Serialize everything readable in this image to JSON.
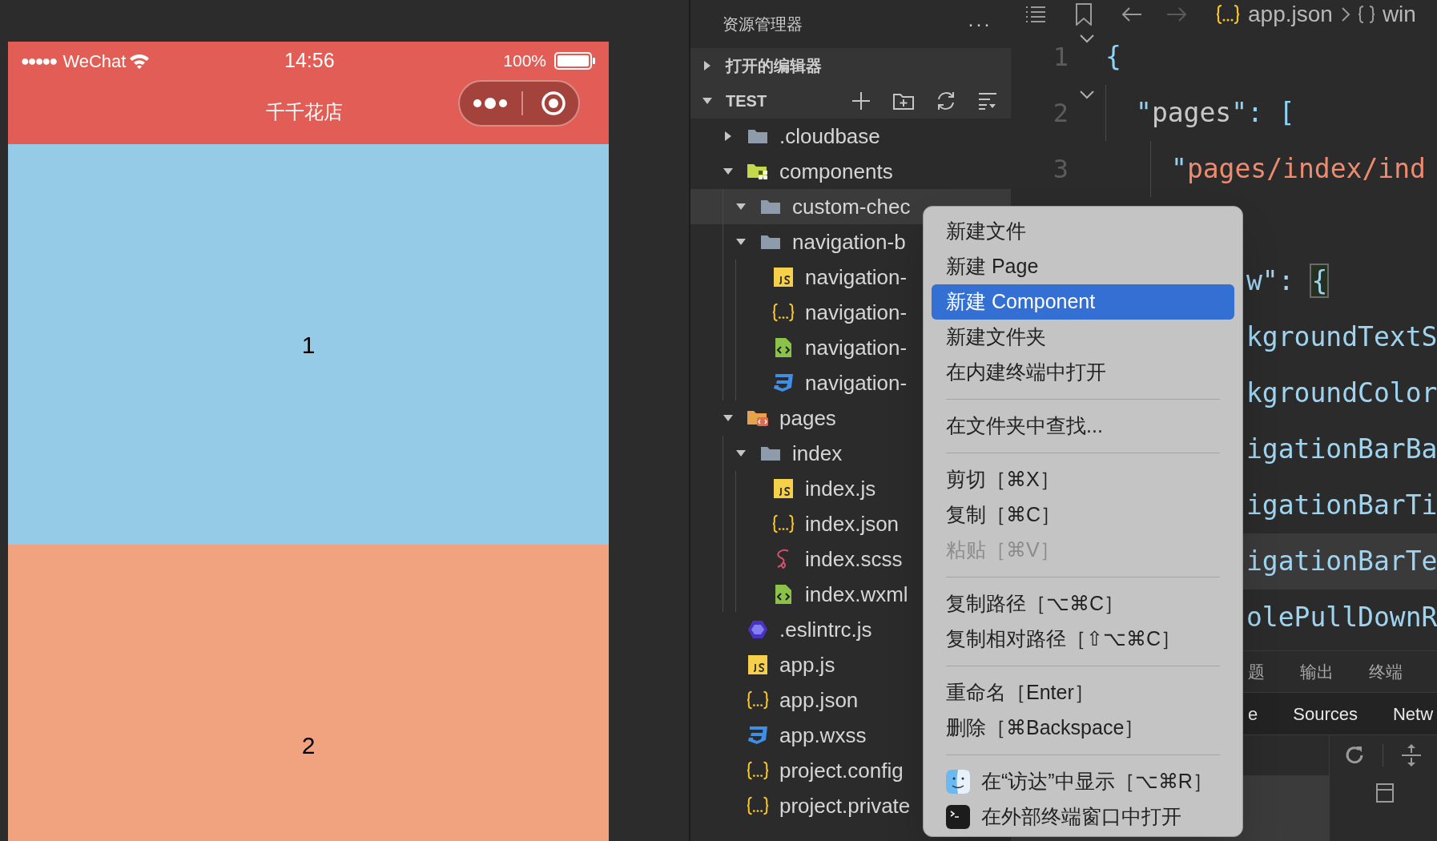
{
  "phone": {
    "status_bar": {
      "signal": "●●●●●",
      "carrier": "WeChat",
      "time": "14:56",
      "battery": "100%"
    },
    "title": "千千花店",
    "blocks": [
      {
        "label": "1",
        "color": "#96cbe8"
      },
      {
        "label": "2",
        "color": "#f1a27f"
      }
    ]
  },
  "explorer": {
    "title": "资源管理器",
    "more": "···",
    "sections": [
      {
        "label": "打开的编辑器",
        "expanded": false
      },
      {
        "label": "TEST",
        "expanded": true
      }
    ],
    "tree": [
      {
        "name": ".cloudbase",
        "kind": "folder",
        "expanded": false,
        "selected": false
      },
      {
        "name": "components",
        "kind": "components",
        "expanded": true,
        "selected": false,
        "children": [
          {
            "name": "custom-chec",
            "kind": "folder",
            "expanded": true,
            "selected": true
          },
          {
            "name": "navigation-b",
            "kind": "folder",
            "expanded": true,
            "selected": false,
            "children": [
              {
                "name": "navigation-",
                "kind": "js",
                "selected": false
              },
              {
                "name": "navigation-",
                "kind": "json",
                "selected": false
              },
              {
                "name": "navigation-",
                "kind": "wxml",
                "selected": false
              },
              {
                "name": "navigation-",
                "kind": "wxss",
                "selected": false
              }
            ]
          }
        ]
      },
      {
        "name": "pages",
        "kind": "pages",
        "expanded": true,
        "selected": false,
        "children": [
          {
            "name": "index",
            "kind": "folder",
            "expanded": true,
            "selected": false,
            "children": [
              {
                "name": "index.js",
                "kind": "js",
                "selected": false
              },
              {
                "name": "index.json",
                "kind": "json",
                "selected": false
              },
              {
                "name": "index.scss",
                "kind": "scss",
                "selected": false
              },
              {
                "name": "index.wxml",
                "kind": "wxml",
                "selected": false
              }
            ]
          }
        ]
      },
      {
        "name": ".eslintrc.js",
        "kind": "eslint",
        "selected": false
      },
      {
        "name": "app.js",
        "kind": "js",
        "selected": false
      },
      {
        "name": "app.json",
        "kind": "json",
        "selected": false
      },
      {
        "name": "app.wxss",
        "kind": "wxss",
        "selected": false
      },
      {
        "name": "project.config",
        "kind": "json",
        "selected": false
      },
      {
        "name": "project.private",
        "kind": "json",
        "selected": false
      }
    ]
  },
  "editor": {
    "breadcrumb": {
      "file": "app.json",
      "symbol": "win"
    },
    "lines": [
      {
        "kind": "full",
        "number": "1",
        "fold": true,
        "highlighted": false,
        "tokens": [
          {
            "text": "{",
            "kind": "punct"
          }
        ]
      },
      {
        "kind": "full",
        "number": "2",
        "fold": true,
        "highlighted": false,
        "tokens": [
          {
            "text": "\"",
            "kind": "punct"
          },
          {
            "text": "pages",
            "kind": "key"
          },
          {
            "text": "\": [",
            "kind": "punct"
          }
        ]
      },
      {
        "kind": "full",
        "number": "3",
        "highlighted": false,
        "tokens": [
          {
            "text": "\"",
            "kind": "punct"
          },
          {
            "text": "pages/index/ind",
            "kind": "string"
          }
        ]
      },
      {
        "kind": "hidden"
      },
      {
        "kind": "partial",
        "highlighted": false,
        "tokens": [
          {
            "text": "w\": ",
            "kind": "prop"
          },
          {
            "text": "{",
            "kind": "bracket-match"
          }
        ]
      },
      {
        "kind": "partial",
        "highlighted": false,
        "tokens": [
          {
            "text": "kgroundTextS",
            "kind": "prop"
          }
        ]
      },
      {
        "kind": "partial",
        "highlighted": false,
        "tokens": [
          {
            "text": "kgroundColor",
            "kind": "prop"
          }
        ]
      },
      {
        "kind": "partial",
        "highlighted": false,
        "tokens": [
          {
            "text": "igationBarBa",
            "kind": "prop"
          }
        ]
      },
      {
        "kind": "partial",
        "highlighted": false,
        "tokens": [
          {
            "text": "igationBarTi",
            "kind": "prop"
          }
        ]
      },
      {
        "kind": "partial",
        "highlighted": true,
        "tokens": [
          {
            "text": "igationBarTe",
            "kind": "prop"
          }
        ]
      },
      {
        "kind": "partial",
        "highlighted": false,
        "tokens": [
          {
            "text": "olePullDownR",
            "kind": "prop"
          }
        ]
      }
    ],
    "panel_tabs": [
      "题",
      "输出",
      "终端"
    ],
    "devtools_tabs": [
      "e",
      "Sources",
      "Netw"
    ]
  },
  "context_menu": [
    {
      "kind": "item",
      "label": "新建文件",
      "selected": false,
      "disabled": false
    },
    {
      "kind": "item",
      "label": "新建 Page",
      "selected": false,
      "disabled": false
    },
    {
      "kind": "item",
      "label": "新建 Component",
      "selected": true,
      "disabled": false
    },
    {
      "kind": "item",
      "label": "新建文件夹",
      "selected": false,
      "disabled": false
    },
    {
      "kind": "item",
      "label": "在内建终端中打开",
      "selected": false,
      "disabled": false
    },
    {
      "kind": "separator"
    },
    {
      "kind": "item",
      "label": "在文件夹中查找...",
      "selected": false,
      "disabled": false
    },
    {
      "kind": "separator"
    },
    {
      "kind": "item",
      "label": "剪切［⌘X］",
      "selected": false,
      "disabled": false
    },
    {
      "kind": "item",
      "label": "复制［⌘C］",
      "selected": false,
      "disabled": false
    },
    {
      "kind": "item",
      "label": "粘贴［⌘V］",
      "selected": false,
      "disabled": true
    },
    {
      "kind": "separator"
    },
    {
      "kind": "item",
      "label": "复制路径［⌥⌘C］",
      "selected": false,
      "disabled": false
    },
    {
      "kind": "item",
      "label": "复制相对路径［⇧⌥⌘C］",
      "selected": false,
      "disabled": false
    },
    {
      "kind": "separator"
    },
    {
      "kind": "item",
      "label": "重命名［Enter］",
      "selected": false,
      "disabled": false
    },
    {
      "kind": "item",
      "label": "删除［⌘Backspace］",
      "selected": false,
      "disabled": false
    },
    {
      "kind": "separator"
    },
    {
      "kind": "finder",
      "label": "在“访达”中显示［⌥⌘R］",
      "selected": false,
      "disabled": false
    },
    {
      "kind": "terminal",
      "label": "在外部终端窗口中打开",
      "selected": false,
      "disabled": false
    }
  ]
}
